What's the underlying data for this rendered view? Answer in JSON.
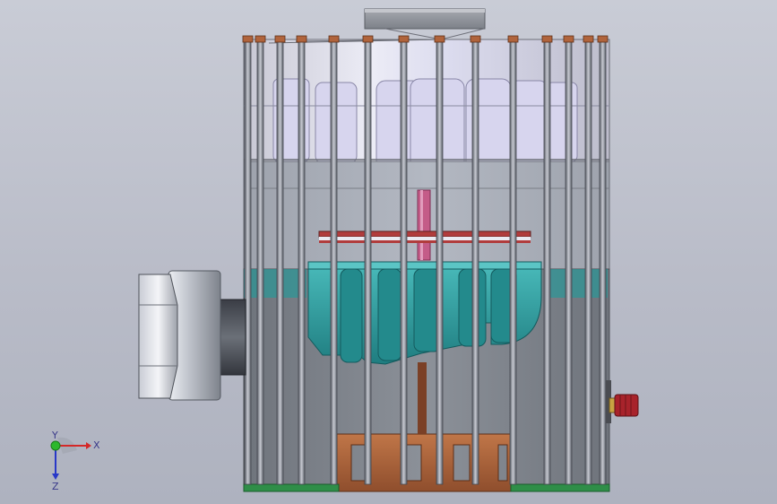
{
  "viewport": {
    "background_top": "#c9ccd6",
    "background_bottom": "#aeb2bf"
  },
  "colors": {
    "housing_grey": "#8e9299",
    "fin_light": "#e8e8f2",
    "impeller_lavender": "#d8d6ee",
    "impeller_teal": "#2a9b9b",
    "shaft_pink": "#c85b8a",
    "plate_red": "#b23a3a",
    "base_copper": "#b0643c",
    "base_green": "#2e8a46",
    "motor_grey": "#9aa0a8",
    "connector_red": "#a8232b"
  },
  "triad": {
    "x_label": "X",
    "y_label": "Y",
    "z_label": "Z",
    "x_color": "#d42828",
    "y_color": "#2cb82c",
    "z_color": "#2838c8"
  }
}
